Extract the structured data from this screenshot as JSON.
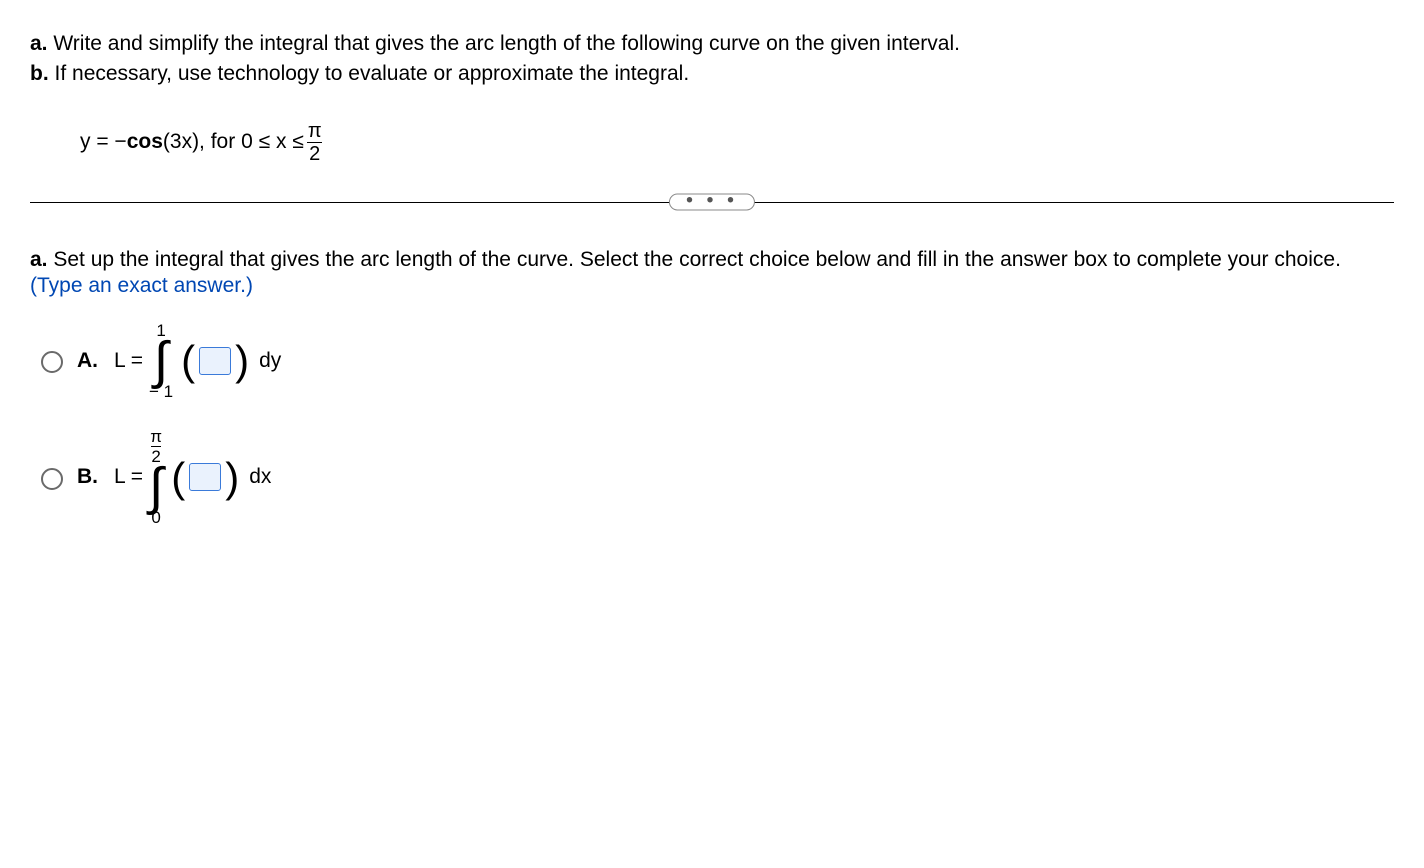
{
  "prompt": {
    "a_label": "a.",
    "a_text": " Write and simplify the integral that gives the arc length of the following curve on the given interval.",
    "b_label": "b.",
    "b_text": " If necessary, use technology to evaluate or approximate the integral."
  },
  "equation": {
    "lhs": "y = − ",
    "func": "cos",
    "arg": " (3x), for 0 ≤ x ≤ ",
    "frac_num": "π",
    "frac_den": "2"
  },
  "divider_dots": "• • •",
  "sub_prompt": {
    "a_label": "a.",
    "line1": " Set up the integral that gives the arc length of the curve. Select the correct choice below and fill in the answer box to complete your choice.",
    "hint": "(Type an exact answer.)"
  },
  "options": {
    "A": {
      "label": "A.",
      "lhs": "L =",
      "upper": "1",
      "lower": "− 1",
      "diff": "dy"
    },
    "B": {
      "label": "B.",
      "lhs": "L =",
      "upper_num": "π",
      "upper_den": "2",
      "lower": "0",
      "diff": "dx"
    }
  }
}
